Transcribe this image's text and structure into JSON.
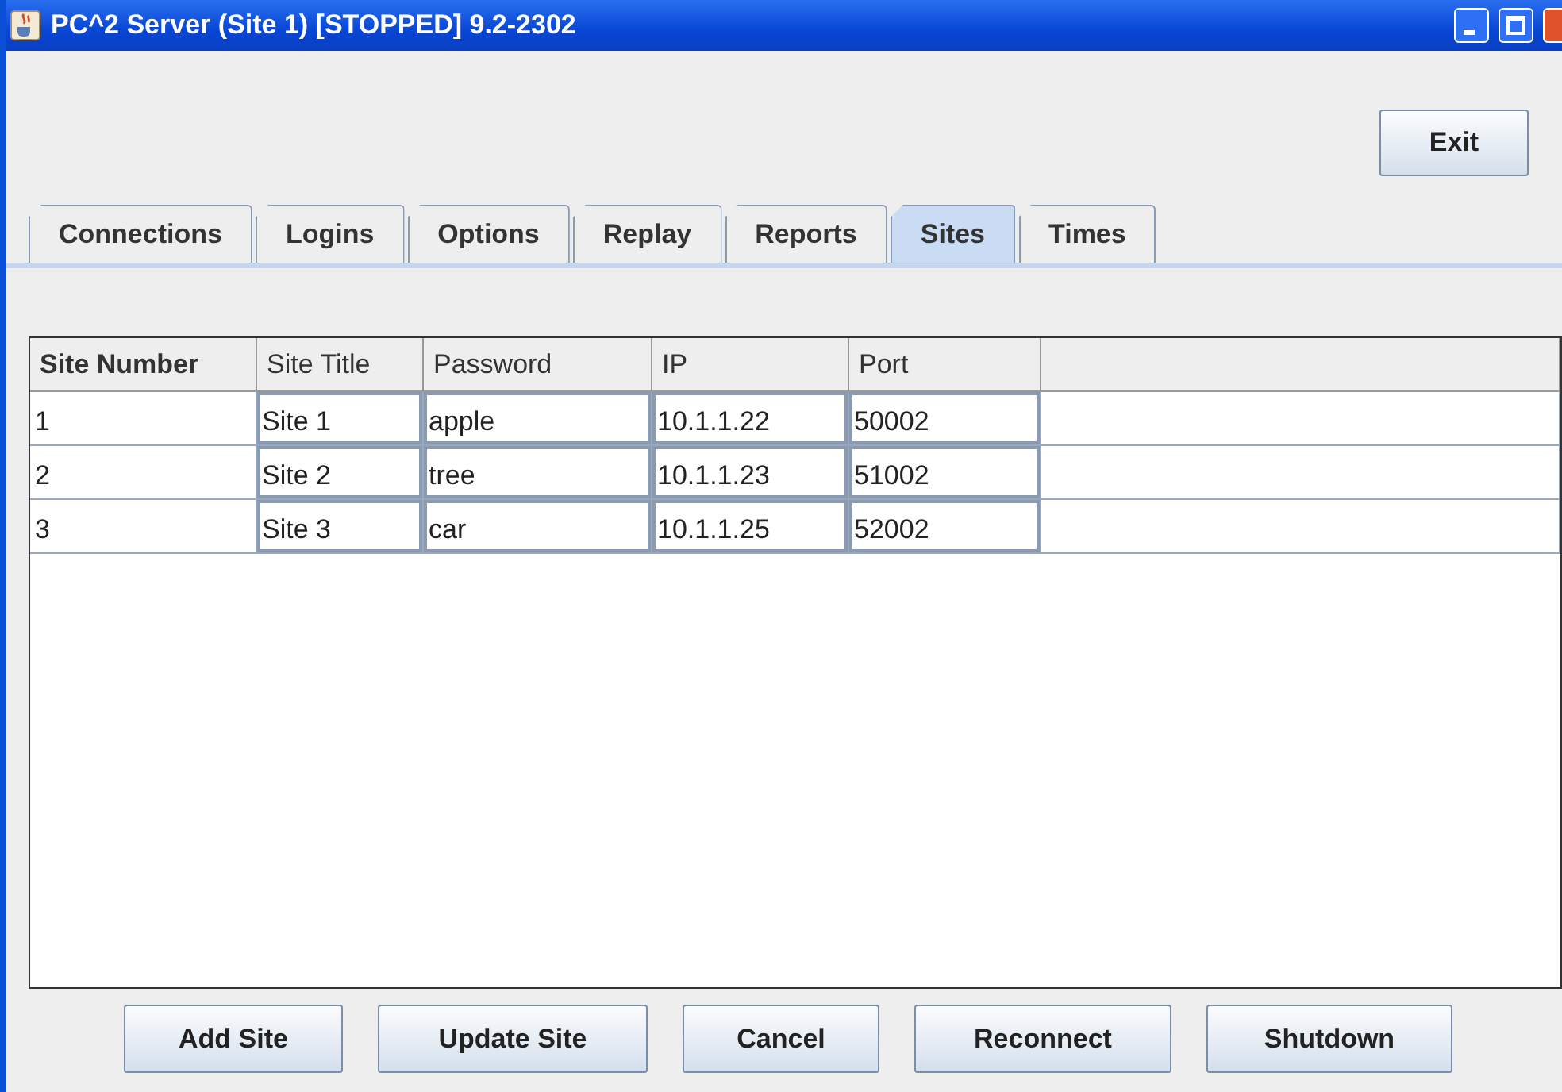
{
  "window": {
    "title": "PC^2 Server (Site 1) [STOPPED] 9.2-2302"
  },
  "exit_button": "Exit",
  "tabs": [
    {
      "label": "Connections",
      "selected": false
    },
    {
      "label": "Logins",
      "selected": false
    },
    {
      "label": "Options",
      "selected": false
    },
    {
      "label": "Replay",
      "selected": false
    },
    {
      "label": "Reports",
      "selected": false
    },
    {
      "label": "Sites",
      "selected": true
    },
    {
      "label": "Times",
      "selected": false
    }
  ],
  "table": {
    "columns": [
      {
        "label": "Site Number",
        "bold": true,
        "editable": false
      },
      {
        "label": "Site Title",
        "bold": false,
        "editable": true
      },
      {
        "label": "Password",
        "bold": false,
        "editable": true
      },
      {
        "label": "IP",
        "bold": false,
        "editable": true
      },
      {
        "label": "Port",
        "bold": false,
        "editable": true
      }
    ],
    "rows": [
      [
        "1",
        "Site 1",
        "apple",
        "10.1.1.22",
        "50002"
      ],
      [
        "2",
        "Site 2",
        "tree",
        "10.1.1.23",
        "51002"
      ],
      [
        "3",
        "Site 3",
        "car",
        "10.1.1.25",
        "52002"
      ]
    ]
  },
  "buttons": [
    "Add Site",
    "Update Site",
    "Cancel",
    "Reconnect",
    "Shutdown"
  ]
}
